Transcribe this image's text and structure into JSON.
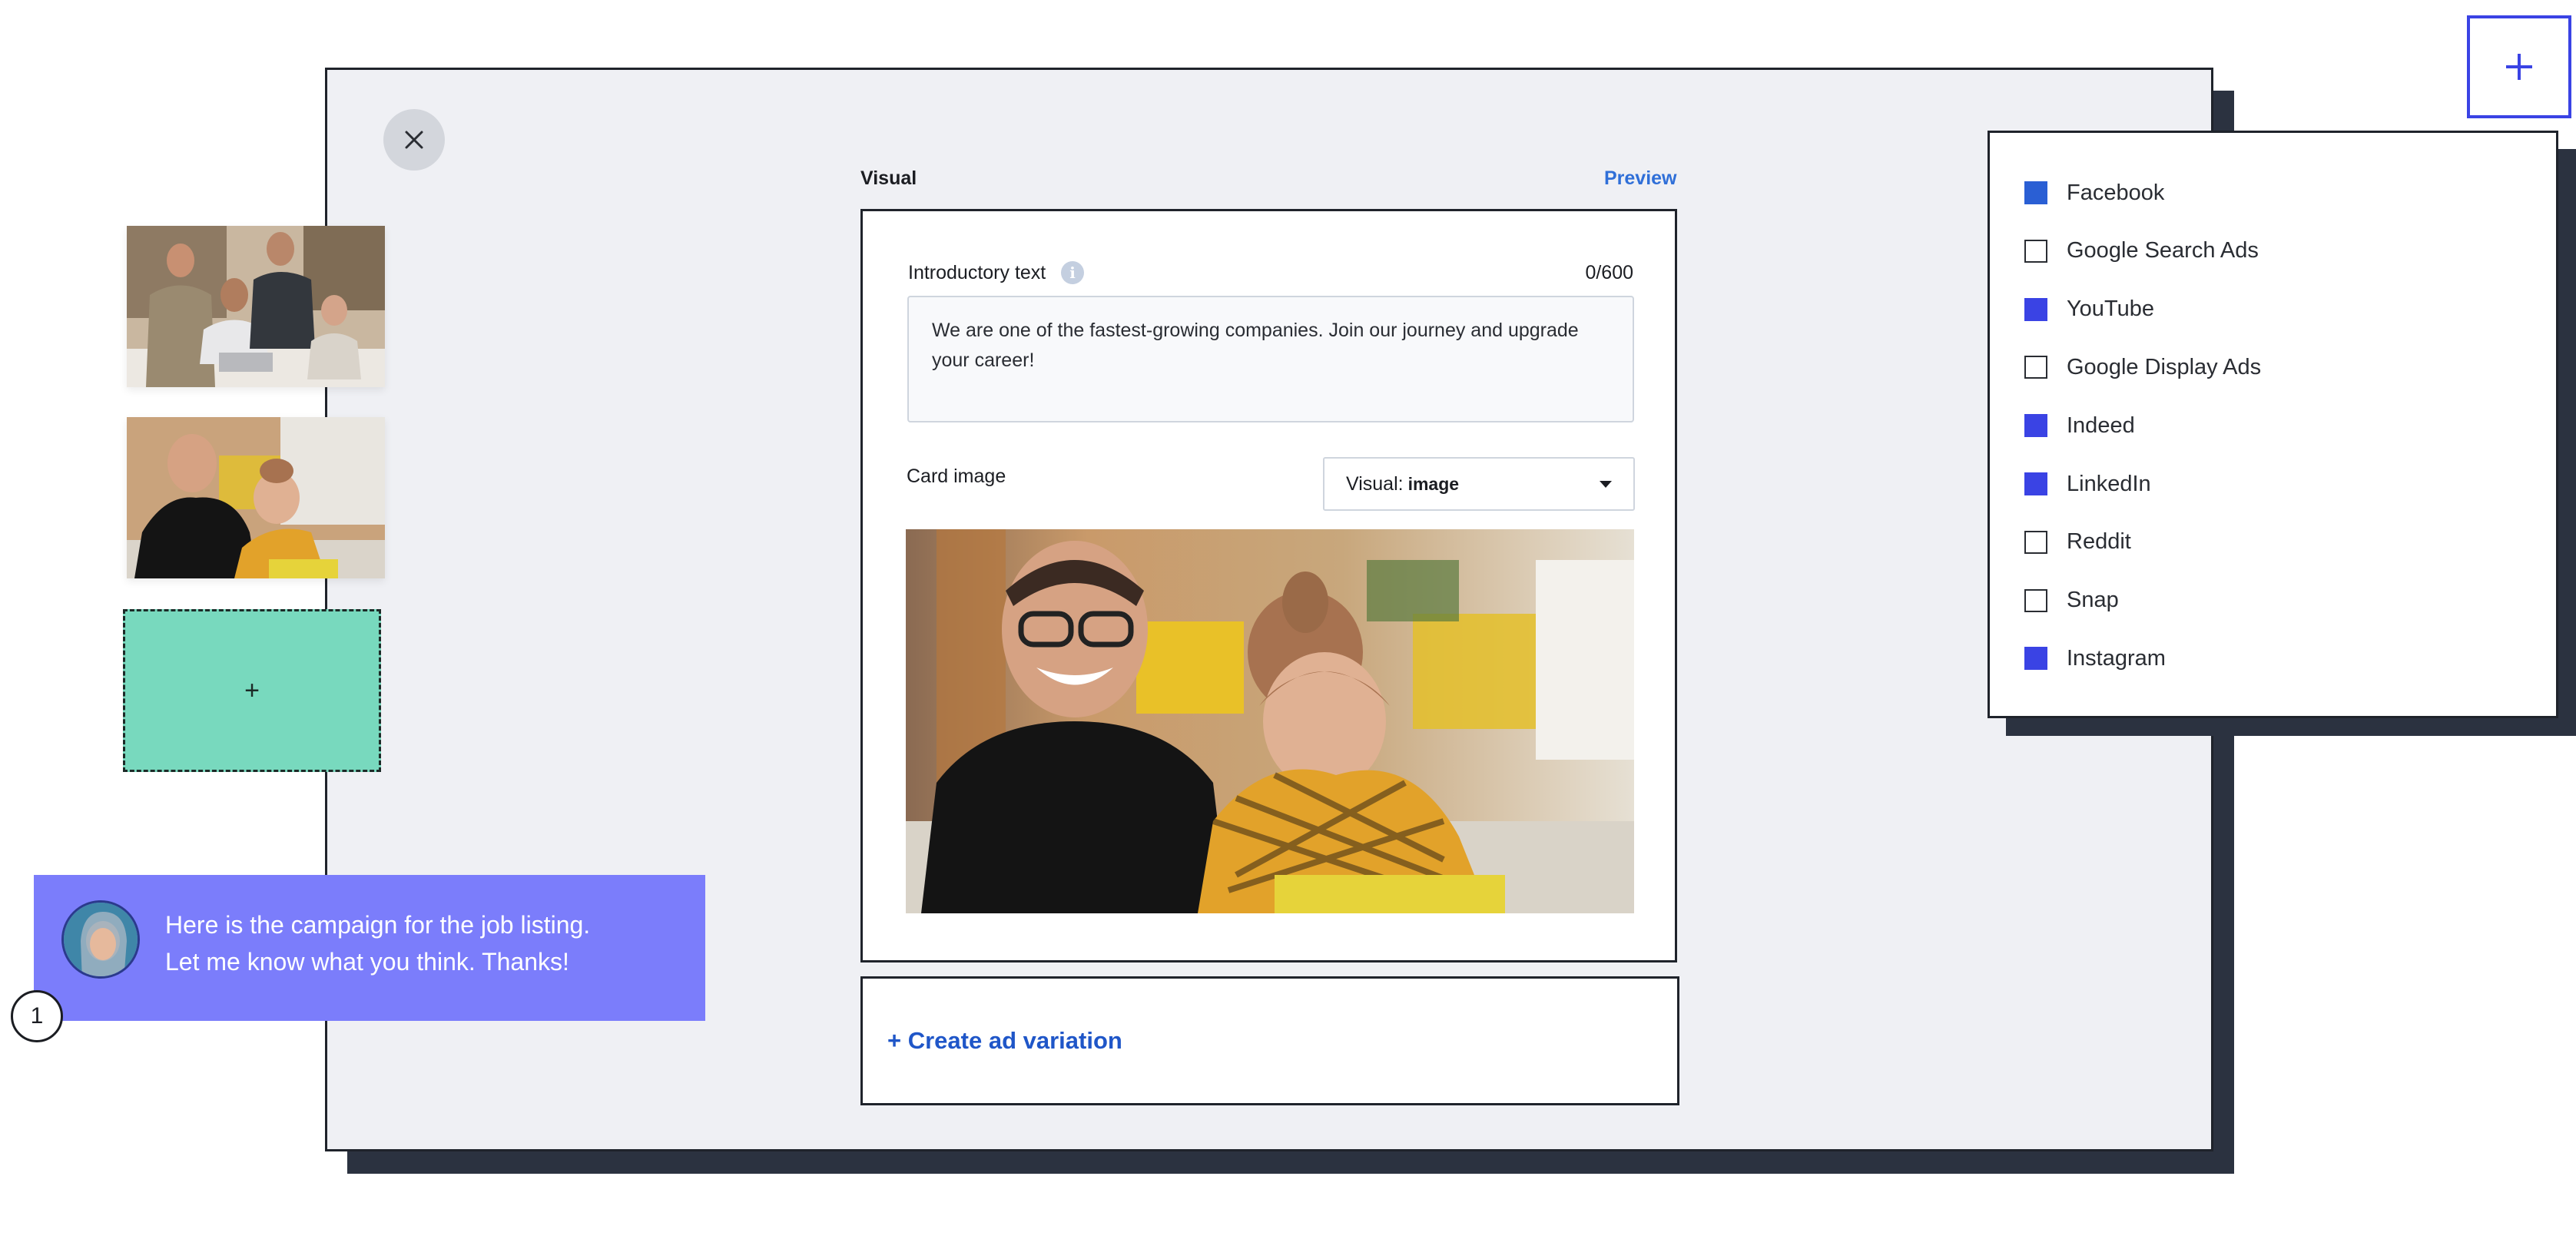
{
  "editor": {
    "section_label": "Visual",
    "preview_label": "Preview",
    "intro": {
      "label": "Introductory text",
      "counter": "0/600",
      "text": "We are one of the fastest-growing companies. Join our journey and upgrade your career!"
    },
    "card_image": {
      "label": "Card image",
      "select_prefix": "Visual:",
      "select_value": "image"
    },
    "create_variation_label": "+ Create ad variation"
  },
  "thumbnails": {
    "add_label": "+"
  },
  "chat": {
    "line1": "Here is the campaign for the job listing.",
    "line2": "Let me know what you think. Thanks!",
    "badge": "1"
  },
  "channels": [
    {
      "label": "Facebook",
      "checked": true
    },
    {
      "label": "Google Search Ads",
      "checked": false
    },
    {
      "label": "YouTube",
      "checked": true
    },
    {
      "label": "Google Display Ads",
      "checked": false
    },
    {
      "label": "Indeed",
      "checked": true
    },
    {
      "label": "LinkedIn",
      "checked": true
    },
    {
      "label": "Reddit",
      "checked": false
    },
    {
      "label": "Snap",
      "checked": false
    },
    {
      "label": "Instagram",
      "checked": true
    }
  ],
  "colors": {
    "accent": "#3a43e4",
    "chat_bg": "#7b7dfb",
    "add_tile": "#78d9be",
    "link": "#1f56c8"
  }
}
